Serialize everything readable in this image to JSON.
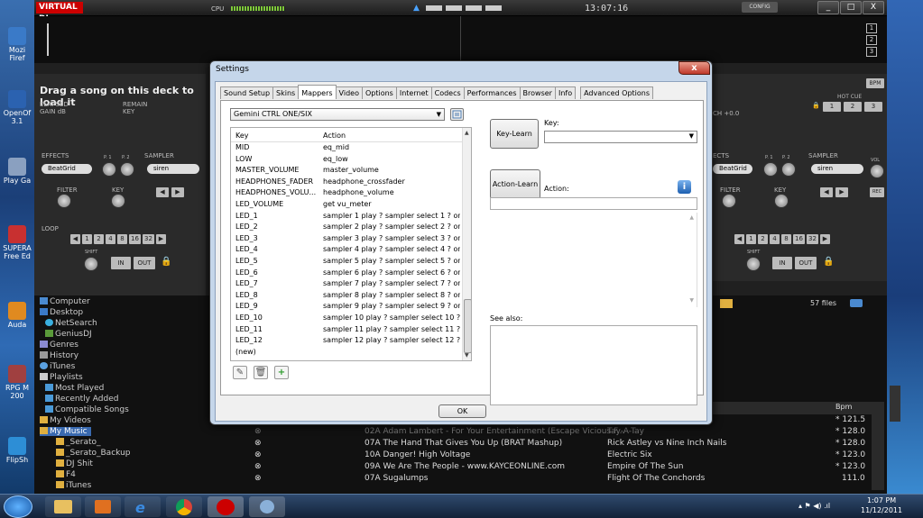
{
  "vdj": {
    "logo": "VIRTUAL DJ",
    "cpu_label": "CPU",
    "clock": "13:07:16",
    "config_label": "CONFIG",
    "window_buttons": [
      "_",
      "□",
      "X"
    ],
    "deck_numbers": [
      "1",
      "2",
      "3"
    ],
    "deck_left": {
      "drag_text": "Drag a song on this deck to load it",
      "elapsed": "ELAPSED",
      "remain": "REMAIN",
      "gain": "GAIN dB",
      "key": "KEY",
      "effects": "EFFECTS",
      "sampler": "SAMPLER",
      "effect_value": "BeatGrid",
      "sampler_value": "siren",
      "filter": "FILTER",
      "key2": "KEY",
      "loop": "LOOP",
      "loop_values": [
        "1",
        "2",
        "4",
        "8",
        "16",
        "32"
      ],
      "shift": "SHIFT",
      "in": "IN",
      "out": "OUT",
      "p1": "P. 1",
      "p2": "P. 2"
    },
    "deck_right": {
      "bpm": "BPM",
      "hot_cue": "HOT CUE",
      "hot_cues": [
        "1",
        "2",
        "3"
      ],
      "pitch": "CH +0.0",
      "effects": "ECTS",
      "sampler": "SAMPLER",
      "vol": "VOL",
      "effect_value": "BeatGrid",
      "sampler_value": "siren",
      "filter": "FILTER",
      "key": "KEY",
      "rec": "REC",
      "loop_values": [
        "1",
        "2",
        "4",
        "8",
        "16",
        "32"
      ],
      "shift": "SHIFT",
      "in": "IN",
      "out": "OUT",
      "p1": "P. 1",
      "p2": "P. 2"
    },
    "browser": {
      "files_count": "57 files",
      "tree": [
        "Computer",
        "Desktop",
        "NetSearch",
        "GeniusDJ",
        "Genres",
        "History",
        "iTunes",
        "Playlists",
        "Most Played",
        "Recently Added",
        "Compatible Songs",
        "My Videos",
        "My Music",
        "_Serato_",
        "_Serato_Backup",
        "DJ Shit",
        "F4",
        "iTunes"
      ],
      "bpm_header": "Bpm",
      "tracks": [
        {
          "title": "",
          "artist": "",
          "bpm": "* 121.5"
        },
        {
          "title": "02A Adam Lambert - For Your Entertainment (Escape Vicious F...",
          "artist": "Tay-A-Tay",
          "bpm": "* 128.0"
        },
        {
          "title": "07A The Hand That Gives You Up (BRAT Mashup)",
          "artist": "Rick Astley vs Nine Inch Nails",
          "bpm": "* 128.0"
        },
        {
          "title": "10A Danger! High Voltage",
          "artist": "Electric Six",
          "bpm": "* 123.0"
        },
        {
          "title": "09A We Are The People - www.KAYCEONLINE.com",
          "artist": "Empire Of The Sun",
          "bpm": "* 123.0"
        },
        {
          "title": "07A Sugalumps",
          "artist": "Flight Of The Conchords",
          "bpm": "111.0"
        }
      ]
    }
  },
  "desktop_icons": [
    "Mozi Firef",
    "OpenOf 3.1",
    "Play Ga",
    "SUPERA Free Ed",
    "Auda",
    "RPG M 200",
    "FlipSh"
  ],
  "dialog": {
    "title": "Settings",
    "close": "x",
    "tabs": [
      "Sound Setup",
      "Skins",
      "Mappers",
      "Video",
      "Options",
      "Internet",
      "Codecs",
      "Performances",
      "Browser",
      "Info",
      "Advanced Options"
    ],
    "active_tab": "Mappers",
    "mapper_select": "Gemini CTRL ONE/SIX",
    "list_header": {
      "key": "Key",
      "action": "Action"
    },
    "rows": [
      {
        "key": "MID",
        "action": "eq_mid"
      },
      {
        "key": "LOW",
        "action": "eq_low"
      },
      {
        "key": "MASTER_VOLUME",
        "action": "master_volume"
      },
      {
        "key": "HEADPHONES_FADER",
        "action": "headphone_crossfader"
      },
      {
        "key": "HEADPHONES_VOLU...",
        "action": "headphone_volume"
      },
      {
        "key": "LED_VOLUME",
        "action": "get vu_meter"
      },
      {
        "key": "LED_1",
        "action": "sampler 1 play ? sampler select 1 ? on ..."
      },
      {
        "key": "LED_2",
        "action": "sampler 2 play ? sampler select 2 ? on ..."
      },
      {
        "key": "LED_3",
        "action": "sampler 3 play ? sampler select 3 ? on ..."
      },
      {
        "key": "LED_4",
        "action": "sampler 4 play ? sampler select 4 ? on ..."
      },
      {
        "key": "LED_5",
        "action": "sampler 5 play ? sampler select 5 ? on ..."
      },
      {
        "key": "LED_6",
        "action": "sampler 6 play ? sampler select 6 ? on ..."
      },
      {
        "key": "LED_7",
        "action": "sampler 7 play ? sampler select 7 ? on ..."
      },
      {
        "key": "LED_8",
        "action": "sampler 8 play ? sampler select 8 ? on ..."
      },
      {
        "key": "LED_9",
        "action": "sampler 9 play ? sampler select 9 ? on ..."
      },
      {
        "key": "LED_10",
        "action": "sampler 10 play ? sampler select 10 ? o..."
      },
      {
        "key": "LED_11",
        "action": "sampler 11 play ? sampler select 11 ? o..."
      },
      {
        "key": "LED_12",
        "action": "sampler 12 play ? sampler select 12 ? o..."
      },
      {
        "key": "(new)",
        "action": ""
      }
    ],
    "key_learn": "Key-Learn",
    "key_label": "Key:",
    "action_learn": "Action-Learn",
    "action_label": "Action:",
    "see_also": "See also:",
    "ok": "OK"
  },
  "taskbar": {
    "time": "1:07 PM",
    "date": "11/12/2011"
  }
}
